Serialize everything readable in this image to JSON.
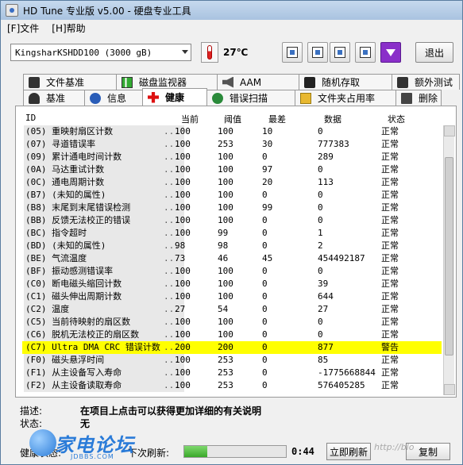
{
  "window": {
    "title": "HD Tune 专业版 v5.00 - 硬盘专业工具"
  },
  "menu": {
    "file": "[F]文件",
    "help": "[H]帮助"
  },
  "toolbar": {
    "drive": "KingsharKSHDD100 (3000 gB)",
    "temperature": "27℃",
    "exit": "退出"
  },
  "tabs_row1": [
    {
      "label": "文件基准",
      "icon": "file-benchmark-icon"
    },
    {
      "label": "磁盘监视器",
      "icon": "disk-monitor-icon"
    },
    {
      "label": "AAM",
      "icon": "speaker-icon"
    },
    {
      "label": "随机存取",
      "icon": "random-access-icon"
    },
    {
      "label": "额外测试",
      "icon": "extra-tests-icon"
    }
  ],
  "tabs_row2": [
    {
      "label": "基准",
      "icon": "benchmark-icon"
    },
    {
      "label": "信息",
      "icon": "info-icon"
    },
    {
      "label": "健康",
      "icon": "health-cross-icon",
      "active": true
    },
    {
      "label": "错误扫描",
      "icon": "error-scan-icon"
    },
    {
      "label": "文件夹占用率",
      "icon": "folder-icon"
    },
    {
      "label": "删除",
      "icon": "trash-icon"
    }
  ],
  "table": {
    "headers": {
      "id": "ID",
      "current": "当前",
      "threshold": "阈值",
      "worst": "最差",
      "data": "数据",
      "status": "状态"
    },
    "rows": [
      {
        "id": "(05) 重映射扇区计数",
        "current": "100",
        "threshold": "100",
        "worst": "10",
        "data": "0",
        "status": "正常"
      },
      {
        "id": "(07) 寻道错误率",
        "current": "100",
        "threshold": "253",
        "worst": "30",
        "data": "777383",
        "status": "正常"
      },
      {
        "id": "(09) 累计通电时间计数",
        "current": "100",
        "threshold": "100",
        "worst": "0",
        "data": "289",
        "status": "正常"
      },
      {
        "id": "(0A) 马达重试计数",
        "current": "100",
        "threshold": "100",
        "worst": "97",
        "data": "0",
        "status": "正常"
      },
      {
        "id": "(0C) 通电周期计数",
        "current": "100",
        "threshold": "100",
        "worst": "20",
        "data": "113",
        "status": "正常"
      },
      {
        "id": "(B7) (未知的属性)",
        "current": "100",
        "threshold": "100",
        "worst": "0",
        "data": "0",
        "status": "正常"
      },
      {
        "id": "(B8) 末尾到末尾错误检测",
        "current": "100",
        "threshold": "100",
        "worst": "99",
        "data": "0",
        "status": "正常"
      },
      {
        "id": "(BB) 反馈无法校正的错误",
        "current": "100",
        "threshold": "100",
        "worst": "0",
        "data": "0",
        "status": "正常"
      },
      {
        "id": "(BC) 指令超时",
        "current": "100",
        "threshold": "99",
        "worst": "0",
        "data": "1",
        "status": "正常"
      },
      {
        "id": "(BD) (未知的属性)",
        "current": "98",
        "threshold": "98",
        "worst": "0",
        "data": "2",
        "status": "正常"
      },
      {
        "id": "(BE) 气流温度",
        "current": "73",
        "threshold": "46",
        "worst": "45",
        "data": "454492187",
        "status": "正常"
      },
      {
        "id": "(BF) 振动感测错误率",
        "current": "100",
        "threshold": "100",
        "worst": "0",
        "data": "0",
        "status": "正常"
      },
      {
        "id": "(C0) 断电磁头缩回计数",
        "current": "100",
        "threshold": "100",
        "worst": "0",
        "data": "39",
        "status": "正常"
      },
      {
        "id": "(C1) 磁头伸出周期计数",
        "current": "100",
        "threshold": "100",
        "worst": "0",
        "data": "644",
        "status": "正常"
      },
      {
        "id": "(C2) 温度",
        "current": "27",
        "threshold": "54",
        "worst": "0",
        "data": "27",
        "status": "正常"
      },
      {
        "id": "(C5) 当前待映射的扇区数",
        "current": "100",
        "threshold": "100",
        "worst": "0",
        "data": "0",
        "status": "正常"
      },
      {
        "id": "(C6) 脱机无法校正的扇区数",
        "current": "100",
        "threshold": "100",
        "worst": "0",
        "data": "0",
        "status": "正常"
      },
      {
        "id": "(C7) Ultra DMA CRC 错误计数",
        "current": "200",
        "threshold": "200",
        "worst": "0",
        "data": "877",
        "status": "警告",
        "warning": true
      },
      {
        "id": "(F0) 磁头悬浮时间",
        "current": "100",
        "threshold": "253",
        "worst": "0",
        "data": "85",
        "status": "正常"
      },
      {
        "id": "(F1) 从主设备写入寿命",
        "current": "100",
        "threshold": "253",
        "worst": "0",
        "data": "-1775668844",
        "status": "正常"
      },
      {
        "id": "(F2) 从主设备读取寿命",
        "current": "100",
        "threshold": "253",
        "worst": "0",
        "data": "576405285",
        "status": "正常"
      }
    ]
  },
  "description": {
    "label": "描述:",
    "value": "在项目上点击可以获得更加详细的有关说明"
  },
  "state": {
    "label": "状态:",
    "value": "无"
  },
  "footer": {
    "health_label": "健康状态:",
    "refresh_label": "下次刷新:",
    "refresh_progress": 0.23,
    "time": "0:44",
    "refresh_now": "立即刷新",
    "copy": "复制"
  },
  "logo": {
    "main": "家电论坛",
    "sub": "JDBBS.COM"
  },
  "watermark": "http://blo"
}
